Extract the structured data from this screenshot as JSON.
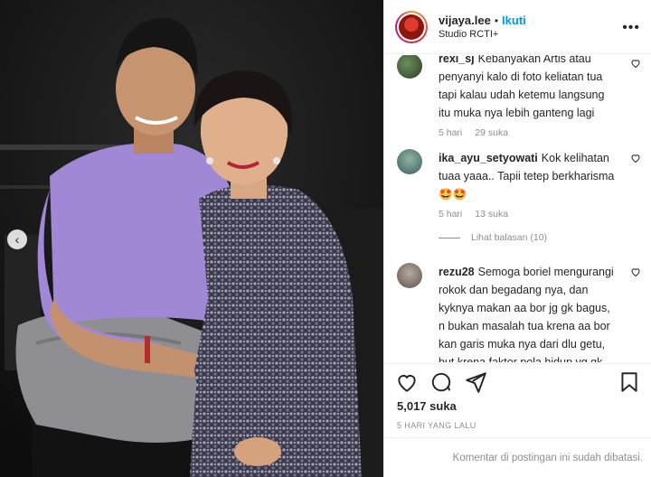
{
  "post": {
    "username": "vijaya.lee",
    "separator": "•",
    "follow_label": "Ikuti",
    "location": "Studio RCTI+",
    "more_label": "•••",
    "carousel_prev": "‹"
  },
  "comments": [
    {
      "user": "rexi_sj",
      "text": "Kebanyakan Artis atau penyanyi kalo di foto keliatan tua tapi kalau udah ketemu langsung itu muka nya lebih ganteng lagi",
      "age": "5 hari",
      "likes": "29 suka"
    },
    {
      "user": "ika_ayu_setyowati",
      "text": "Kok kelihatan tuaa yaaa.. Tapii tetep berkharisma🤩🤩",
      "age": "5 hari",
      "likes": "13 suka",
      "view_replies": "Lihat balasan (10)"
    },
    {
      "user": "rezu28",
      "text": "Semoga boriel mengurangi rokok dan begadang nya, dan kyknya makan aa bor jg gk bagus, n bukan masalah tua krena aa bor kan garis muka nya dari dlu getu, but krena faktor pola hidup yg gk baik, jdi keliatan"
    }
  ],
  "stats": {
    "likes": "5,017 suka",
    "posted": "5 HARI YANG LALU"
  },
  "footer": {
    "comments_closed": "Komentar di postingan ini sudah dibatasi."
  },
  "icons": {
    "like": "heart-icon",
    "comment": "comment-icon",
    "share": "paper-plane-icon",
    "save": "bookmark-icon"
  },
  "colors": {
    "accent": "#0095f6",
    "text": "#262626",
    "muted": "#8e8e8e",
    "border": "#efefef"
  }
}
